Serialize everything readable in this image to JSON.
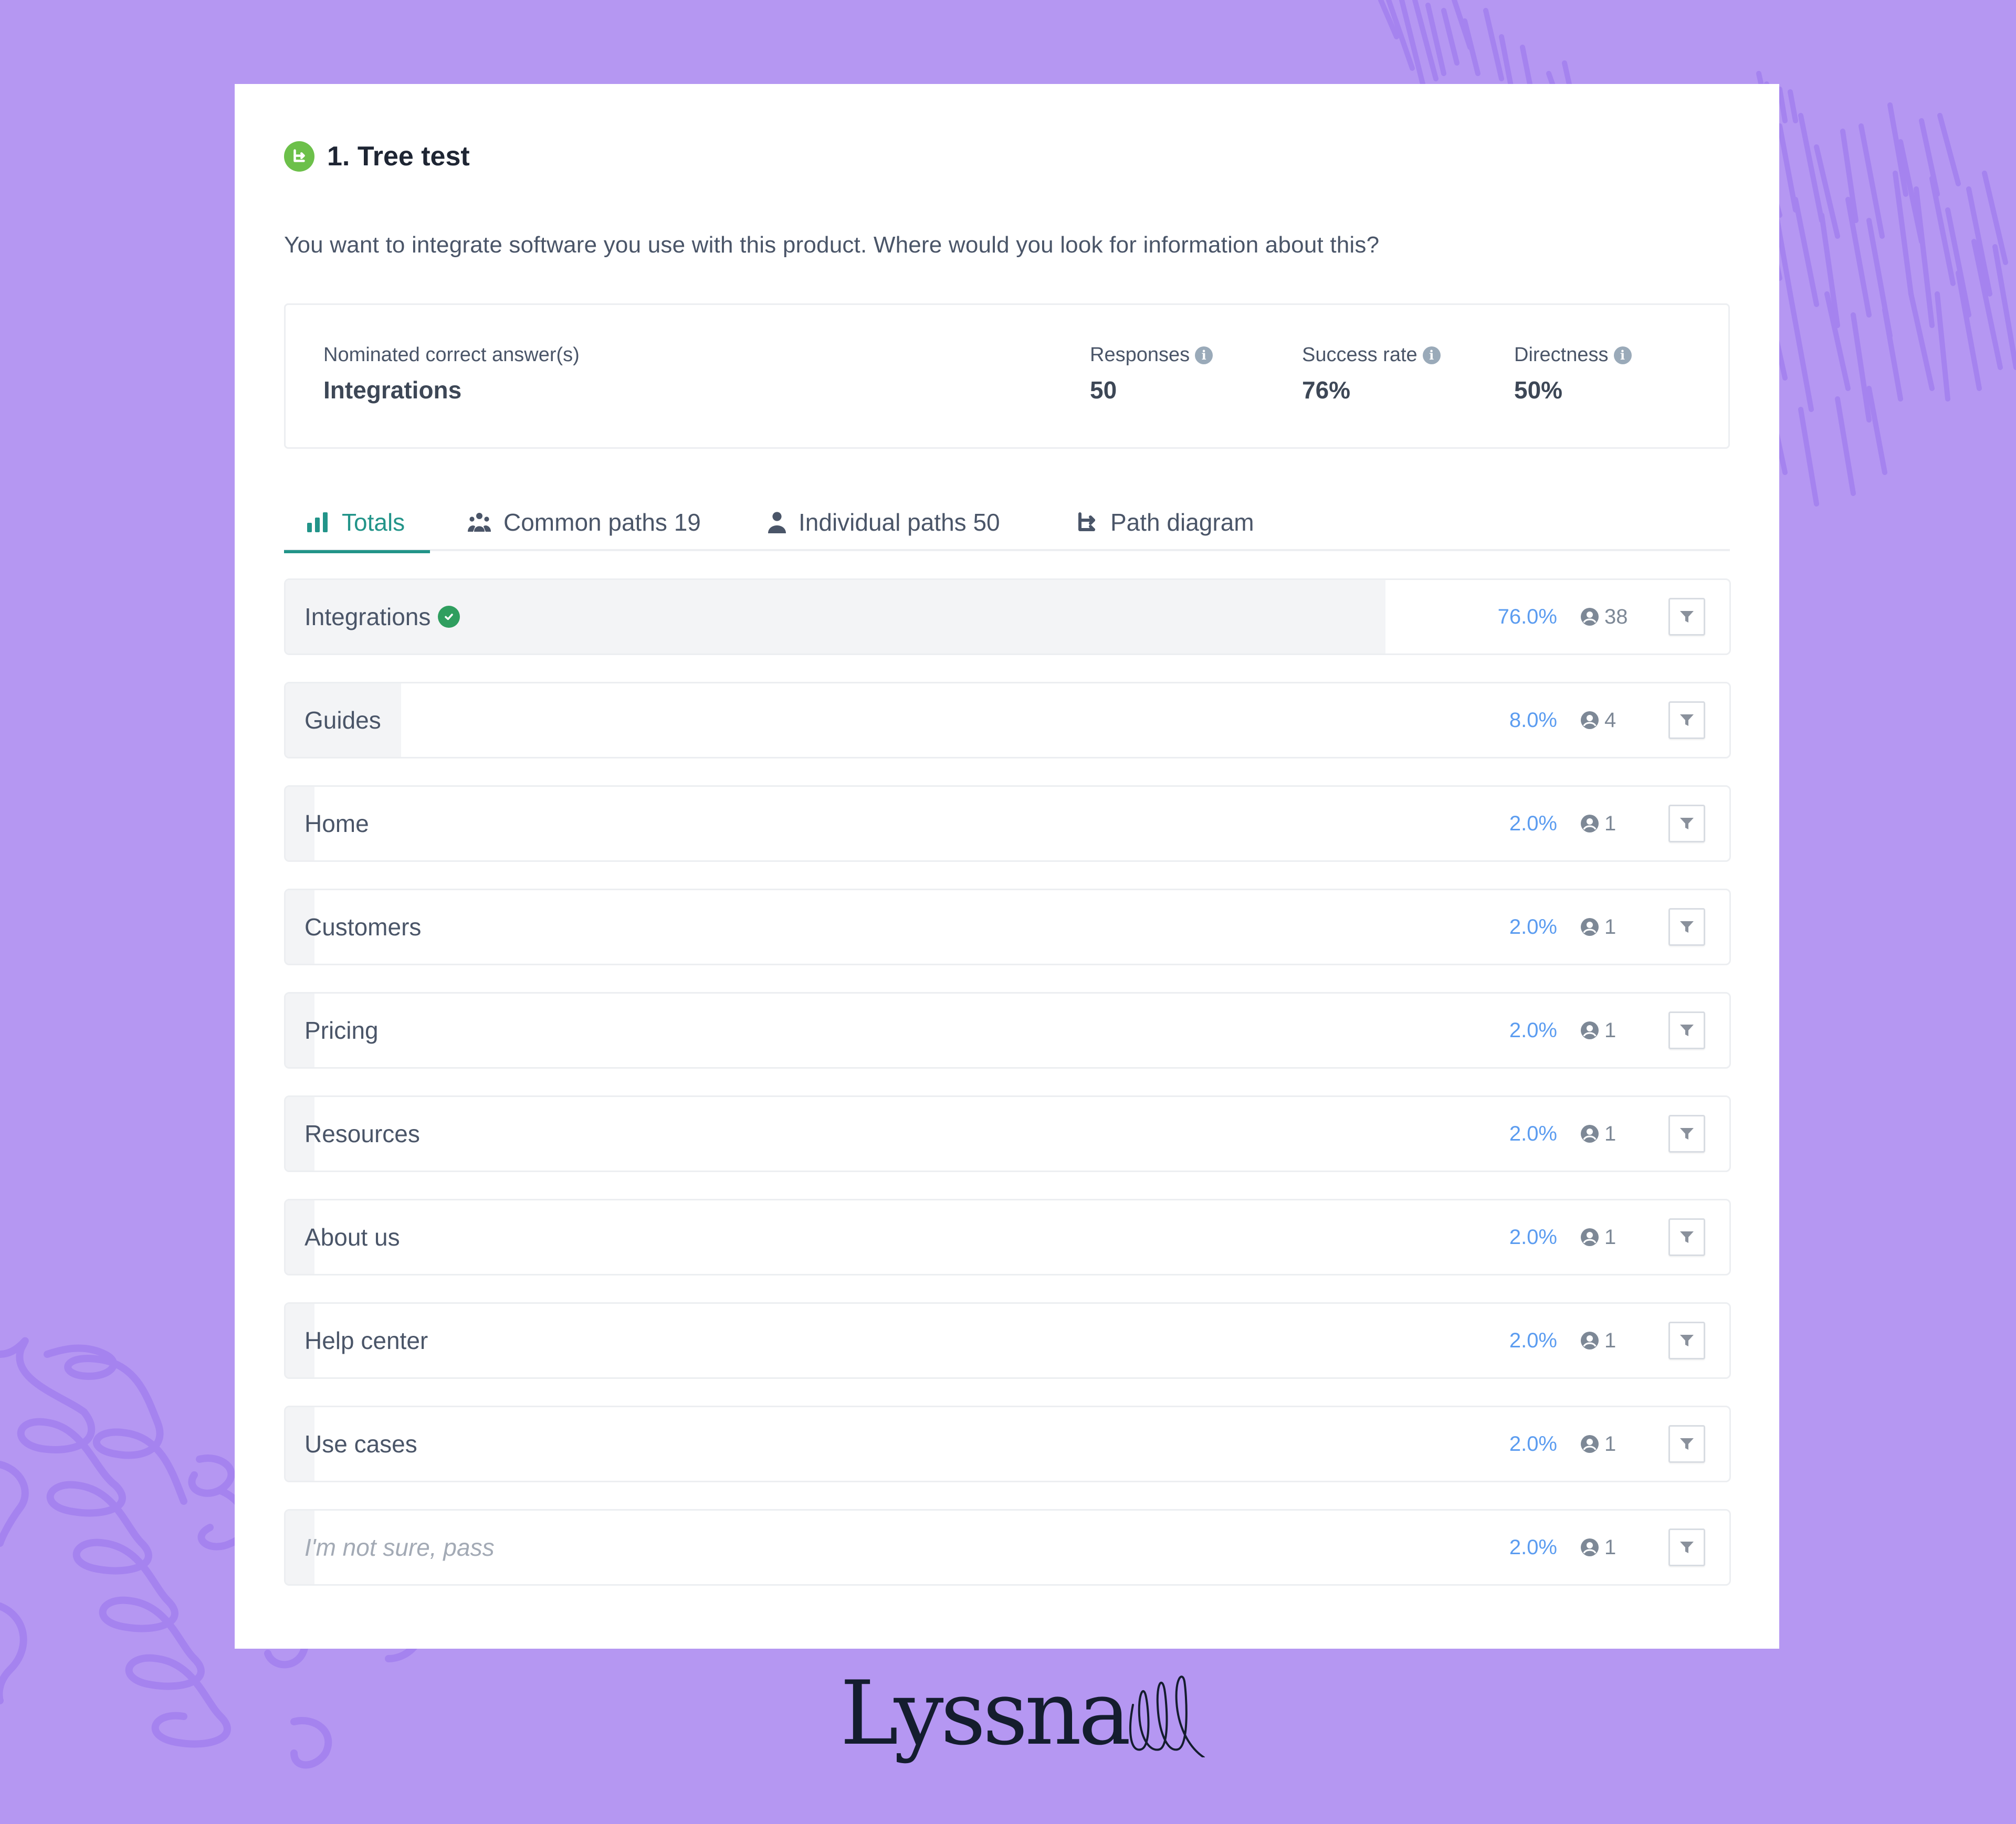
{
  "background": {
    "color": "#b597f2",
    "pattern_color": "#a583ef"
  },
  "header": {
    "icon": "tree-test-icon",
    "title": "1. Tree test",
    "icon_color": "#6cc04a"
  },
  "question": "You want to integrate software you use with this product. Where would you look for information about this?",
  "stats": {
    "correct_answer_label": "Nominated correct answer(s)",
    "correct_answer_value": "Integrations",
    "metrics": [
      {
        "label": "Responses",
        "value": "50",
        "icon": "info-icon"
      },
      {
        "label": "Success rate",
        "value": "76%",
        "icon": "info-icon"
      },
      {
        "label": "Directness",
        "value": "50%",
        "icon": "info-icon"
      }
    ]
  },
  "tabs": [
    {
      "label": "Totals",
      "icon": "bar-chart-icon",
      "active": true
    },
    {
      "label": "Common paths 19",
      "icon": "group-icon",
      "active": false
    },
    {
      "label": "Individual paths 50",
      "icon": "person-icon",
      "active": false
    },
    {
      "label": "Path diagram",
      "icon": "path-diagram-icon",
      "active": false
    }
  ],
  "accent_color": "#229489",
  "percent_color": "#5b9cf0",
  "results": [
    {
      "label": "Integrations",
      "percent": 76.0,
      "percent_text": "76.0%",
      "count": "38",
      "correct": true,
      "italic": false
    },
    {
      "label": "Guides",
      "percent": 8.0,
      "percent_text": "8.0%",
      "count": "4",
      "correct": false,
      "italic": false
    },
    {
      "label": "Home",
      "percent": 2.0,
      "percent_text": "2.0%",
      "count": "1",
      "correct": false,
      "italic": false
    },
    {
      "label": "Customers",
      "percent": 2.0,
      "percent_text": "2.0%",
      "count": "1",
      "correct": false,
      "italic": false
    },
    {
      "label": "Pricing",
      "percent": 2.0,
      "percent_text": "2.0%",
      "count": "1",
      "correct": false,
      "italic": false
    },
    {
      "label": "Resources",
      "percent": 2.0,
      "percent_text": "2.0%",
      "count": "1",
      "correct": false,
      "italic": false
    },
    {
      "label": "About us",
      "percent": 2.0,
      "percent_text": "2.0%",
      "count": "1",
      "correct": false,
      "italic": false
    },
    {
      "label": "Help center",
      "percent": 2.0,
      "percent_text": "2.0%",
      "count": "1",
      "correct": false,
      "italic": false
    },
    {
      "label": "Use cases",
      "percent": 2.0,
      "percent_text": "2.0%",
      "count": "1",
      "correct": false,
      "italic": false
    },
    {
      "label": "I'm not sure, pass",
      "percent": 2.0,
      "percent_text": "2.0%",
      "count": "1",
      "correct": false,
      "italic": true
    }
  ],
  "branding": {
    "logo_text": "Lyssna",
    "logo_color": "#141d2e"
  }
}
